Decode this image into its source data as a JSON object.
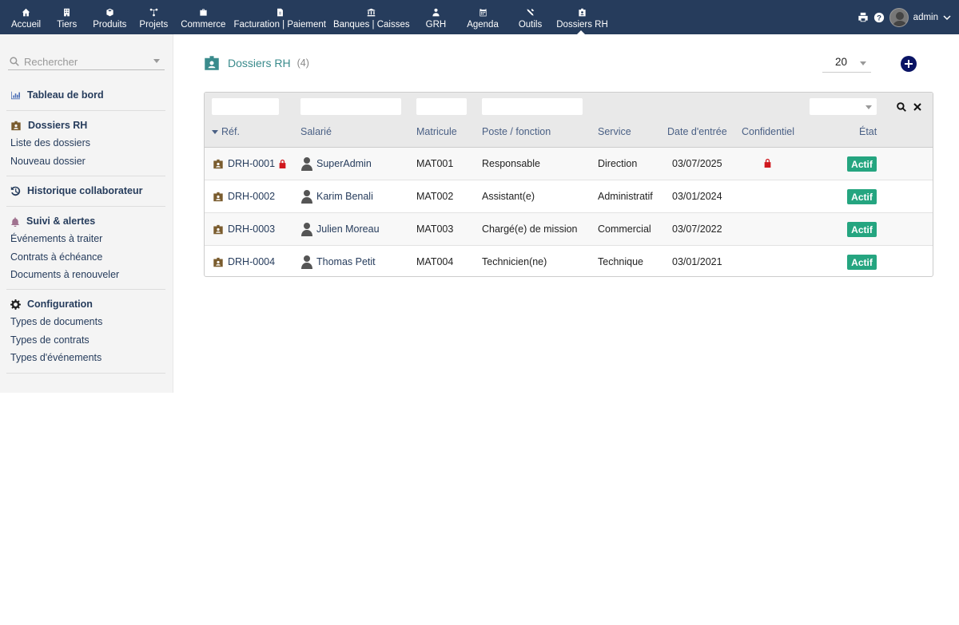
{
  "colors": {
    "topbar": "#263c5c",
    "accent": "#3a8b8c",
    "badge_active": "#25a580",
    "lock": "#d0181e"
  },
  "topmenu": [
    {
      "label": "Accueil",
      "icon": "home-icon"
    },
    {
      "label": "Tiers",
      "icon": "building-icon"
    },
    {
      "label": "Produits",
      "icon": "cube-icon"
    },
    {
      "label": "Projets",
      "icon": "sitemap-icon"
    },
    {
      "label": "Commerce",
      "icon": "suitcase-icon"
    },
    {
      "label": "Facturation | Paiement",
      "icon": "file-invoice-icon"
    },
    {
      "label": "Banques | Caisses",
      "icon": "bank-icon"
    },
    {
      "label": "GRH",
      "icon": "user-tie-icon"
    },
    {
      "label": "Agenda",
      "icon": "calendar-icon"
    },
    {
      "label": "Outils",
      "icon": "tools-icon"
    },
    {
      "label": "Dossiers RH",
      "icon": "id-badge-icon",
      "active": true
    }
  ],
  "user": {
    "name": "admin"
  },
  "sidebar": {
    "search_placeholder": "Rechercher",
    "dashboard": "Tableau de bord",
    "dossiers": {
      "title": "Dossiers RH",
      "items": [
        "Liste des dossiers",
        "Nouveau dossier"
      ]
    },
    "historique": "Historique collaborateur",
    "suivi": {
      "title": "Suivi & alertes",
      "items": [
        "Événements à traiter",
        "Contrats à échéance",
        "Documents à renouveler"
      ]
    },
    "config": {
      "title": "Configuration",
      "items": [
        "Types de documents",
        "Types de contrats",
        "Types d'événements"
      ]
    }
  },
  "page": {
    "title": "Dossiers RH",
    "count": "(4)",
    "page_size": "20"
  },
  "table": {
    "columns": {
      "ref": "Réf.",
      "salarie": "Salarié",
      "matricule": "Matricule",
      "poste": "Poste / fonction",
      "service": "Service",
      "date": "Date d'entrée",
      "confidentiel": "Confidentiel",
      "etat": "État"
    },
    "rows": [
      {
        "ref": "DRH-0001",
        "salarie": "SuperAdmin",
        "matricule": "MAT001",
        "poste": "Responsable",
        "service": "Direction",
        "date": "03/07/2025",
        "confidentiel": true,
        "etat": "Actif"
      },
      {
        "ref": "DRH-0002",
        "salarie": "Karim Benali",
        "matricule": "MAT002",
        "poste": "Assistant(e)",
        "service": "Administratif",
        "date": "03/01/2024",
        "confidentiel": false,
        "etat": "Actif"
      },
      {
        "ref": "DRH-0003",
        "salarie": "Julien Moreau",
        "matricule": "MAT003",
        "poste": "Chargé(e) de mission",
        "service": "Commercial",
        "date": "03/07/2022",
        "confidentiel": false,
        "etat": "Actif"
      },
      {
        "ref": "DRH-0004",
        "salarie": "Thomas Petit",
        "matricule": "MAT004",
        "poste": "Technicien(ne)",
        "service": "Technique",
        "date": "03/01/2021",
        "confidentiel": false,
        "etat": "Actif"
      }
    ]
  }
}
